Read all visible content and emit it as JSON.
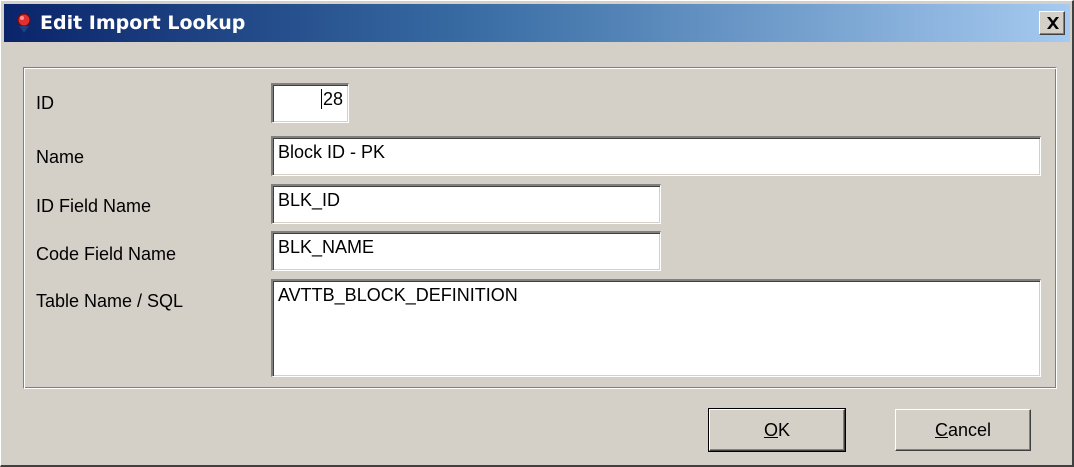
{
  "window": {
    "title": "Edit Import Lookup",
    "icon": "app-icon",
    "close_icon": "close-icon"
  },
  "form": {
    "id": {
      "label": "ID",
      "value": "28"
    },
    "name": {
      "label": "Name",
      "value": "Block ID - PK"
    },
    "id_field_name": {
      "label": "ID Field Name",
      "value": "BLK_ID"
    },
    "code_field_name": {
      "label": "Code Field Name",
      "value": "BLK_NAME"
    },
    "table_name": {
      "label": "Table Name / SQL",
      "value": "AVTTB_BLOCK_DEFINITION"
    }
  },
  "buttons": {
    "ok": {
      "accel": "O",
      "rest": "K"
    },
    "cancel": {
      "accel": "C",
      "rest": "ancel"
    }
  },
  "colors": {
    "title_start": "#0a246a",
    "title_end": "#a6caf0",
    "face": "#d4d0c8"
  }
}
